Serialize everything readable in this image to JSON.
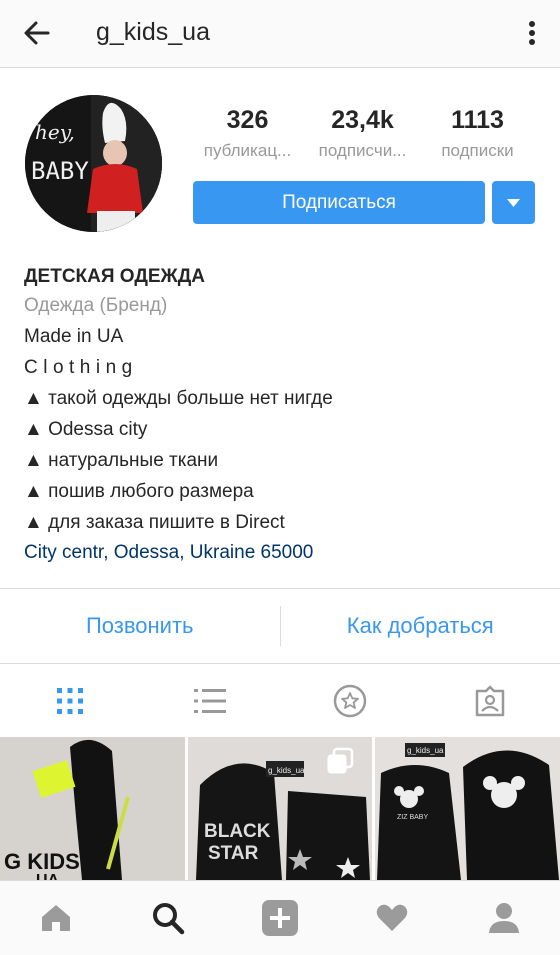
{
  "header": {
    "username": "g_kids_ua",
    "back_icon": "arrow-left-icon",
    "more_icon": "more-vertical-icon"
  },
  "profile": {
    "avatar_text_line1": "hey,",
    "avatar_text_line2": "BABY",
    "stats": [
      {
        "value": "326",
        "label": "публикац..."
      },
      {
        "value": "23,4k",
        "label": "подписчи..."
      },
      {
        "value": "1113",
        "label": "подписки"
      }
    ],
    "follow_label": "Подписаться",
    "dropdown_icon": "caret-down-icon"
  },
  "bio": {
    "name": "ДЕТСКАЯ ОДЕЖДА",
    "category": "Одежда (Бренд)",
    "lines": [
      "Made in UA",
      "Clothing",
      "▲ такой одежды больше нет нигде",
      "▲ Odessa city",
      "▲ натуральные ткани",
      "▲ пошив любого размера",
      "▲ для заказа пишите в Direct"
    ],
    "address": "City centr, Odessa, Ukraine 65000"
  },
  "actions": {
    "call": "Позвонить",
    "directions": "Как добраться"
  },
  "tabs": [
    {
      "icon": "grid-icon",
      "active": true
    },
    {
      "icon": "list-icon",
      "active": false
    },
    {
      "icon": "star-circle-icon",
      "active": false
    },
    {
      "icon": "tagged-user-icon",
      "active": false
    }
  ],
  "grid": {
    "post1_text_line1": "G KIDS",
    "post1_text_line2": "UA",
    "post2_text_line1": "BLACK",
    "post2_text_line2": "STAR",
    "post2_tag": "g_kids_ua",
    "post3_tag": "g_kids_ua",
    "post3_text": "ZIZ BABY"
  },
  "bottom_nav": [
    {
      "icon": "home-icon"
    },
    {
      "icon": "search-icon",
      "active": true
    },
    {
      "icon": "add-icon"
    },
    {
      "icon": "heart-icon"
    },
    {
      "icon": "profile-icon"
    }
  ],
  "colors": {
    "accent": "#3897f0",
    "text": "#262626",
    "muted": "#999999",
    "link": "#003569"
  }
}
